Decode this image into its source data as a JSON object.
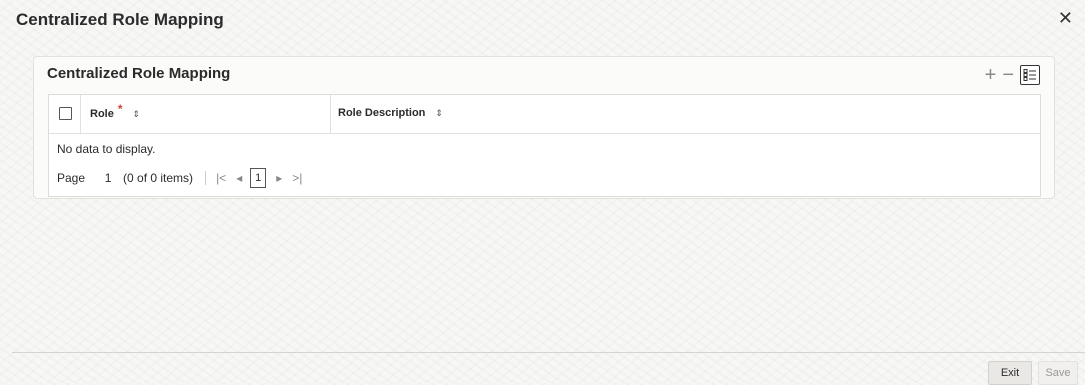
{
  "window": {
    "title": "Centralized Role Mapping",
    "close_glyph": "✕"
  },
  "panel": {
    "title": "Centralized Role Mapping",
    "tools": {
      "add": "+",
      "remove": "−"
    }
  },
  "grid": {
    "columns": [
      {
        "label": "Role",
        "required_mark": "*",
        "sort_glyph": "⇕"
      },
      {
        "label": "Role Description",
        "sort_glyph": "⇕"
      }
    ],
    "empty_message": "No data to display.",
    "pager": {
      "label": "Page",
      "page_value": "1",
      "items_text": "(0 of 0 items)",
      "first": "|<",
      "prev": "◂",
      "current_page": "1",
      "next": "▸",
      "last": ">|"
    }
  },
  "footer": {
    "exit_label": "Exit",
    "save_label": "Save"
  },
  "colors": {
    "required": "#c74634",
    "accent_text": "#2b2b2b",
    "background": "#f7f7f6"
  }
}
